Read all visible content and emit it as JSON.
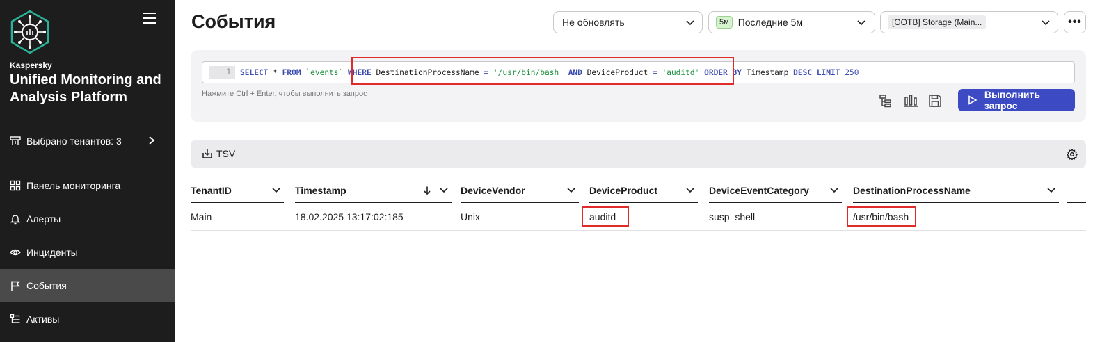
{
  "sidebar": {
    "brand_small": "Kaspersky",
    "brand_big": "Unified Monitoring and Analysis Platform",
    "tenants_label": "Выбрано тенантов: 3",
    "items": [
      {
        "label": "Панель мониторинга",
        "icon": "dashboard-icon"
      },
      {
        "label": "Алерты",
        "icon": "bell-icon"
      },
      {
        "label": "Инциденты",
        "icon": "eye-icon"
      },
      {
        "label": "События",
        "icon": "flag-icon",
        "active": true
      },
      {
        "label": "Активы",
        "icon": "assets-icon"
      }
    ]
  },
  "header": {
    "title": "События",
    "refresh_select": "Не обновлять",
    "period_badge": "5м",
    "period_select": "Последние 5м",
    "storage_select": "[OOTB] Storage (Main..."
  },
  "query": {
    "line_number": "1",
    "tokens": {
      "select": "SELECT",
      "star": "*",
      "from": "FROM",
      "table": "`events`",
      "where": "WHERE",
      "field1": "DestinationProcessName",
      "eq1": "=",
      "val1": "'/usr/bin/bash'",
      "and": "AND",
      "field2": "DeviceProduct",
      "eq2": "=",
      "val2": "'auditd'",
      "order": "ORDER BY",
      "order_field": "Timestamp",
      "desc": "DESC",
      "limit": "LIMIT",
      "limit_val": "250"
    },
    "hint": "Нажмите Ctrl + Enter, чтобы выполнить запрос",
    "run_label": "Выполнить запрос"
  },
  "results": {
    "export_label": "TSV",
    "columns": [
      "TenantID",
      "Timestamp",
      "DeviceVendor",
      "DeviceProduct",
      "DeviceEventCategory",
      "DestinationProcessName"
    ],
    "rows": [
      [
        "Main",
        "18.02.2025 13:17:02:185",
        "Unix",
        "auditd",
        "susp_shell",
        "/usr/bin/bash"
      ]
    ]
  },
  "colors": {
    "sidebar_bg": "#1d1d1d",
    "accent": "#3c4bc4",
    "highlight": "#e02b2b"
  }
}
